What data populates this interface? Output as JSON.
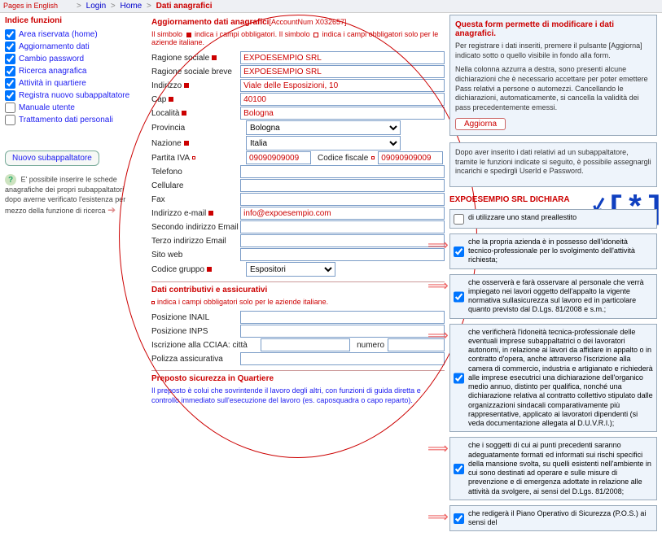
{
  "topbar": {
    "pages_label": "Pages in English",
    "breadcrumb": {
      "login": "Login",
      "home": "Home",
      "current": "Dati anagrafici"
    }
  },
  "sidebar": {
    "title": "Indice funzioni",
    "items": [
      {
        "label": "Area riservata (home)"
      },
      {
        "label": "Aggiornamento dati"
      },
      {
        "label": "Cambio password"
      },
      {
        "label": "Ricerca anagrafica"
      },
      {
        "label": "Attività in quartiere"
      },
      {
        "label": "Registra nuovo subappaltatore"
      },
      {
        "label": "Manuale utente"
      },
      {
        "label": "Trattamento dati personali"
      }
    ],
    "new_sub": "Nuovo subappaltatore",
    "tip": "E' possibile inserire le schede anagrafiche dei propri subappaltatori dopo averne verificato l'esistenza per mezzo della funzione di ricerca"
  },
  "form": {
    "title": "Aggiornamento dati anagrafici",
    "account": "[AccountNum X032657]",
    "hint_a": "Il simbolo",
    "hint_b": "indica i campi obbligatori. Il simbolo",
    "hint_c": "indica i campi obbligatori solo per le aziende italiane.",
    "labels": {
      "ragione": "Ragione sociale",
      "ragione_breve": "Ragione sociale breve",
      "indirizzo": "Indirizzo",
      "cap": "Cap",
      "localita": "Località",
      "provincia": "Provincia",
      "nazione": "Nazione",
      "piva": "Partita IVA",
      "cfisc": "Codice fiscale",
      "telefono": "Telefono",
      "cellulare": "Cellulare",
      "fax": "Fax",
      "email": "Indirizzo e-mail",
      "email2": "Secondo indirizzo Email",
      "email3": "Terzo indirizzo Email",
      "sitoweb": "Sito web",
      "codgruppo": "Codice gruppo"
    },
    "values": {
      "ragione": "EXPOESEMPIO SRL",
      "ragione_breve": "EXPOESEMPIO SRL",
      "indirizzo": "Viale delle Esposizioni, 10",
      "cap": "40100",
      "localita": "Bologna",
      "piva": "09090909009",
      "cfisc": "09090909009",
      "email": "info@expoesempio.com"
    },
    "selects": {
      "provincia": "Bologna",
      "nazione": "Italia",
      "codgruppo": "Espositori"
    },
    "section2_title": "Dati contributivi e assicurativi",
    "section2_hint": "indica i campi obbligatori solo per le aziende italiane.",
    "labels2": {
      "pos_inail": "Posizione INAIL",
      "pos_inps": "Posizione INPS",
      "cciaa": "Iscrizione alla CCIAA: città",
      "numero": "numero",
      "polizza": "Polizza assicurativa"
    },
    "section3_title": "Preposto sicurezza in Quartiere",
    "section3_desc": "Il preposto è colui che sovrintende il lavoro degli altri, con funzioni di guida diretta e controllo immediato sull'esecuzione del lavoro (es. caposquadra o capo reparto)."
  },
  "right": {
    "top_title": "Questa form permette di modificare i dati anagrafici.",
    "top_p1": "Per registrare i dati inseriti, premere il pulsante [Aggiorna] indicato sotto o quello visibile in fondo alla form.",
    "top_p2": "Nella colonna azzurra a destra, sono presenti alcune dichiarazioni che è necessario accettare per poter emettere Pass relativi a persone o automezzi.  Cancellando le dichiarazioni, automaticamente, si cancella la validità dei pass precedentemente emessi.",
    "update_btn": "Aggiorna",
    "second_p": "Dopo aver inserito i dati relativi ad un subappaltatore, tramite le funzioni indicate si seguito, è possibile assegnargli incarichi e spedirgli UserId e Password.",
    "declare_title": "EXPOESEMPIO SRL DICHIARA",
    "declares": [
      {
        "checked": false,
        "text": "di utilizzare uno stand preallestito"
      },
      {
        "checked": true,
        "text": "che la propria azienda è in possesso dell'idoneità tecnico-professionale per lo svolgimento dell'attività richiesta;"
      },
      {
        "checked": true,
        "text": "che osserverà e farà osservare al personale che verrà impiegato nei lavori oggetto dell'appalto la vigente normativa sullasicurezza sul lavoro ed in particolare quanto previsto dal D.Lgs. 81/2008 e s.m.;"
      },
      {
        "checked": true,
        "text": "che verificherà l'idoneità tecnica-professionale delle eventuali imprese subappaltatrici o dei lavoratori autonomi, in relazione ai lavori da affidare in appalto o in contratto d'opera, anche attraverso l'iscrizione alla camera di commercio, industria e artigianato e richiederà alle imprese esecutrici una dichiarazione dell'organico medio annuo, distinto per qualifica, nonché una dichiarazione relativa al contratto collettivo stipulato dalle organizzazioni sindacali comparativamente più rappresentative, applicato ai lavoratori dipendenti (si veda documentazione allegata al D.U.V.R.I.);"
      },
      {
        "checked": true,
        "text": "che i soggetti di cui ai punti precedenti saranno adeguatamente formati ed informati sui rischi specifici della mansione svolta, su quelli esistenti nell'ambiente in cui sono destinati ad operare e sulle misure di prevenzione e di emergenza adottate in relazione alle attività da svolgere, ai sensi del D.Lgs. 81/2008;"
      },
      {
        "checked": true,
        "text": "che redigerà il Piano Operativo di Sicurezza (P.O.S.) ai sensi del"
      }
    ]
  }
}
